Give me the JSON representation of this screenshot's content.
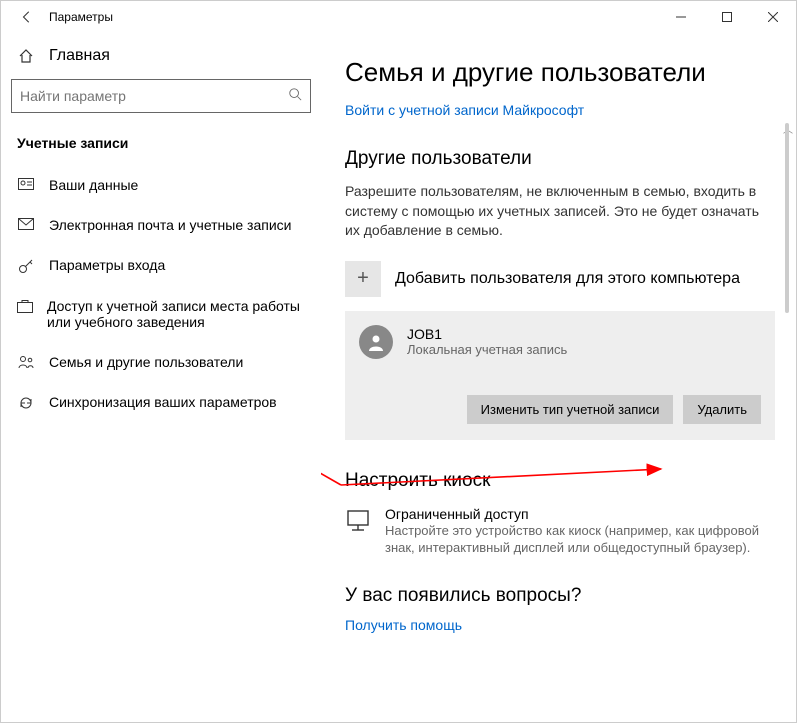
{
  "titlebar": {
    "title": "Параметры"
  },
  "sidebar": {
    "home": "Главная",
    "search_placeholder": "Найти параметр",
    "section": "Учетные записи",
    "items": [
      {
        "label": "Ваши данные"
      },
      {
        "label": "Электронная почта и учетные записи"
      },
      {
        "label": "Параметры входа"
      },
      {
        "label": "Доступ к учетной записи места работы или учебного заведения"
      },
      {
        "label": "Семья и другие пользователи"
      },
      {
        "label": "Синхронизация ваших параметров"
      }
    ]
  },
  "main": {
    "heading": "Семья и другие пользователи",
    "signin_link": "Войти с учетной записи Майкрософт",
    "other_users_heading": "Другие пользователи",
    "other_users_desc": "Разрешите пользователям, не включенным в семью, входить в систему с помощью их учетных записей. Это не будет означать их добавление в семью.",
    "add_user": "Добавить пользователя для этого компьютера",
    "user": {
      "name": "JOB1",
      "sub": "Локальная учетная запись",
      "change_type": "Изменить тип учетной записи",
      "delete": "Удалить"
    },
    "kiosk_heading": "Настроить киоск",
    "kiosk_title": "Ограниченный доступ",
    "kiosk_desc": "Настройте это устройство как киоск (например, как цифровой знак, интерактивный дисплей или общедоступный браузер).",
    "questions_heading": "У вас появились вопросы?",
    "get_help": "Получить помощь"
  }
}
